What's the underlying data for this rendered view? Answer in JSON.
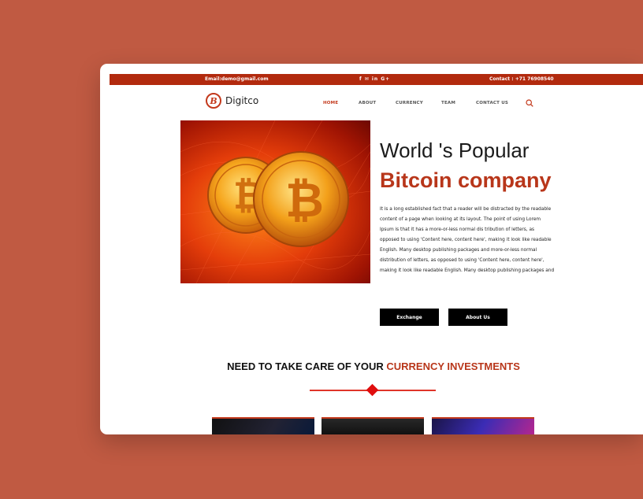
{
  "topbar": {
    "email": "Email:demo@gmail.com",
    "social": "f  ✉  in  G+",
    "contact": "Contact : +71 76908540"
  },
  "logo": {
    "mark": "B",
    "text": "Digitco"
  },
  "nav": {
    "home": "HOME",
    "about": "ABOUT",
    "currency": "CURRENCY",
    "team": "TEAM",
    "contact": "CONTACT US"
  },
  "hero": {
    "title_line1": "World 's Popular",
    "title_line2": "Bitcoin company",
    "paragraph": "It is a long established fact that a reader will be distracted by the readable content of a page when looking at its layout. The point of using Lorem Ipsum is that it has a more-or-less normal dis tribution of letters, as opposed to using 'Content here, content here', making it look like readable English. Many desktop publishing packages and more-or-less normal distribution of letters, as opposed to using 'Content here, content here', making it look like readable English. Many desktop publishing packages and"
  },
  "buttons": {
    "exchange": "Exchange",
    "about": "About Us"
  },
  "section": {
    "title_main": "NEED TO TAKE CARE OF YOUR ",
    "title_accent": "CURRENCY INVESTMENTS"
  },
  "colors": {
    "background": "#c05a42",
    "accent": "#b8361a",
    "topbar": "#b22a0e"
  }
}
